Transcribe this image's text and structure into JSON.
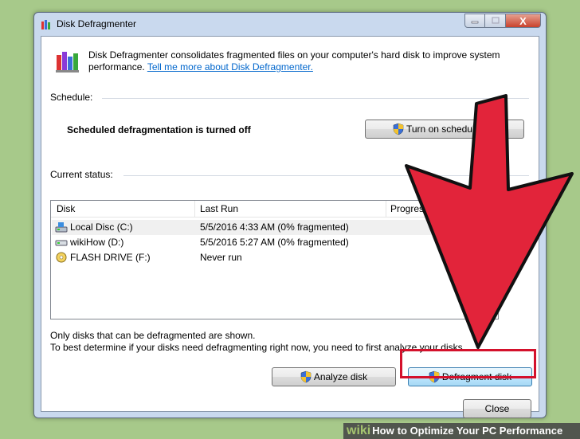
{
  "window": {
    "title": "Disk Defragmenter",
    "buttons": {
      "minimize": "minimize",
      "maximize": "maximize",
      "close": "X"
    }
  },
  "header": {
    "description": "Disk Defragmenter consolidates fragmented files on your computer's hard disk to improve system performance.",
    "link": "Tell me more about Disk Defragmenter."
  },
  "schedule": {
    "label": "Schedule:",
    "status": "Scheduled defragmentation is turned off",
    "button": "Turn on schedule..."
  },
  "current_status": {
    "label": "Current status:",
    "columns": [
      "Disk",
      "Last Run",
      "Progress"
    ],
    "rows": [
      {
        "disk": "Local Disc (C:)",
        "last_run": "5/5/2016 4:33 AM (0% fragmented)",
        "progress": "",
        "icon": "hard-drive-icon"
      },
      {
        "disk": "wikiHow (D:)",
        "last_run": "5/5/2016 5:27 AM (0% fragmented)",
        "progress": "",
        "icon": "drive-icon"
      },
      {
        "disk": "FLASH DRIVE (F:)",
        "last_run": "Never run",
        "progress": "",
        "icon": "flash-drive-icon"
      }
    ]
  },
  "notes": {
    "line1": "Only disks that can be defragmented are shown.",
    "line2": "To best determine if your disks need defragmenting right now, you need to first analyze your disks."
  },
  "actions": {
    "analyze": "Analyze disk",
    "defragment": "Defragment disk",
    "close": "Close"
  },
  "caption": {
    "wiki": "wiki",
    "how": "How",
    "text": "to Optimize Your PC Performance"
  },
  "colors": {
    "background": "#a7c98a",
    "arrow": "#e2243a",
    "highlight": "#d4112c",
    "link": "#0066cc"
  }
}
